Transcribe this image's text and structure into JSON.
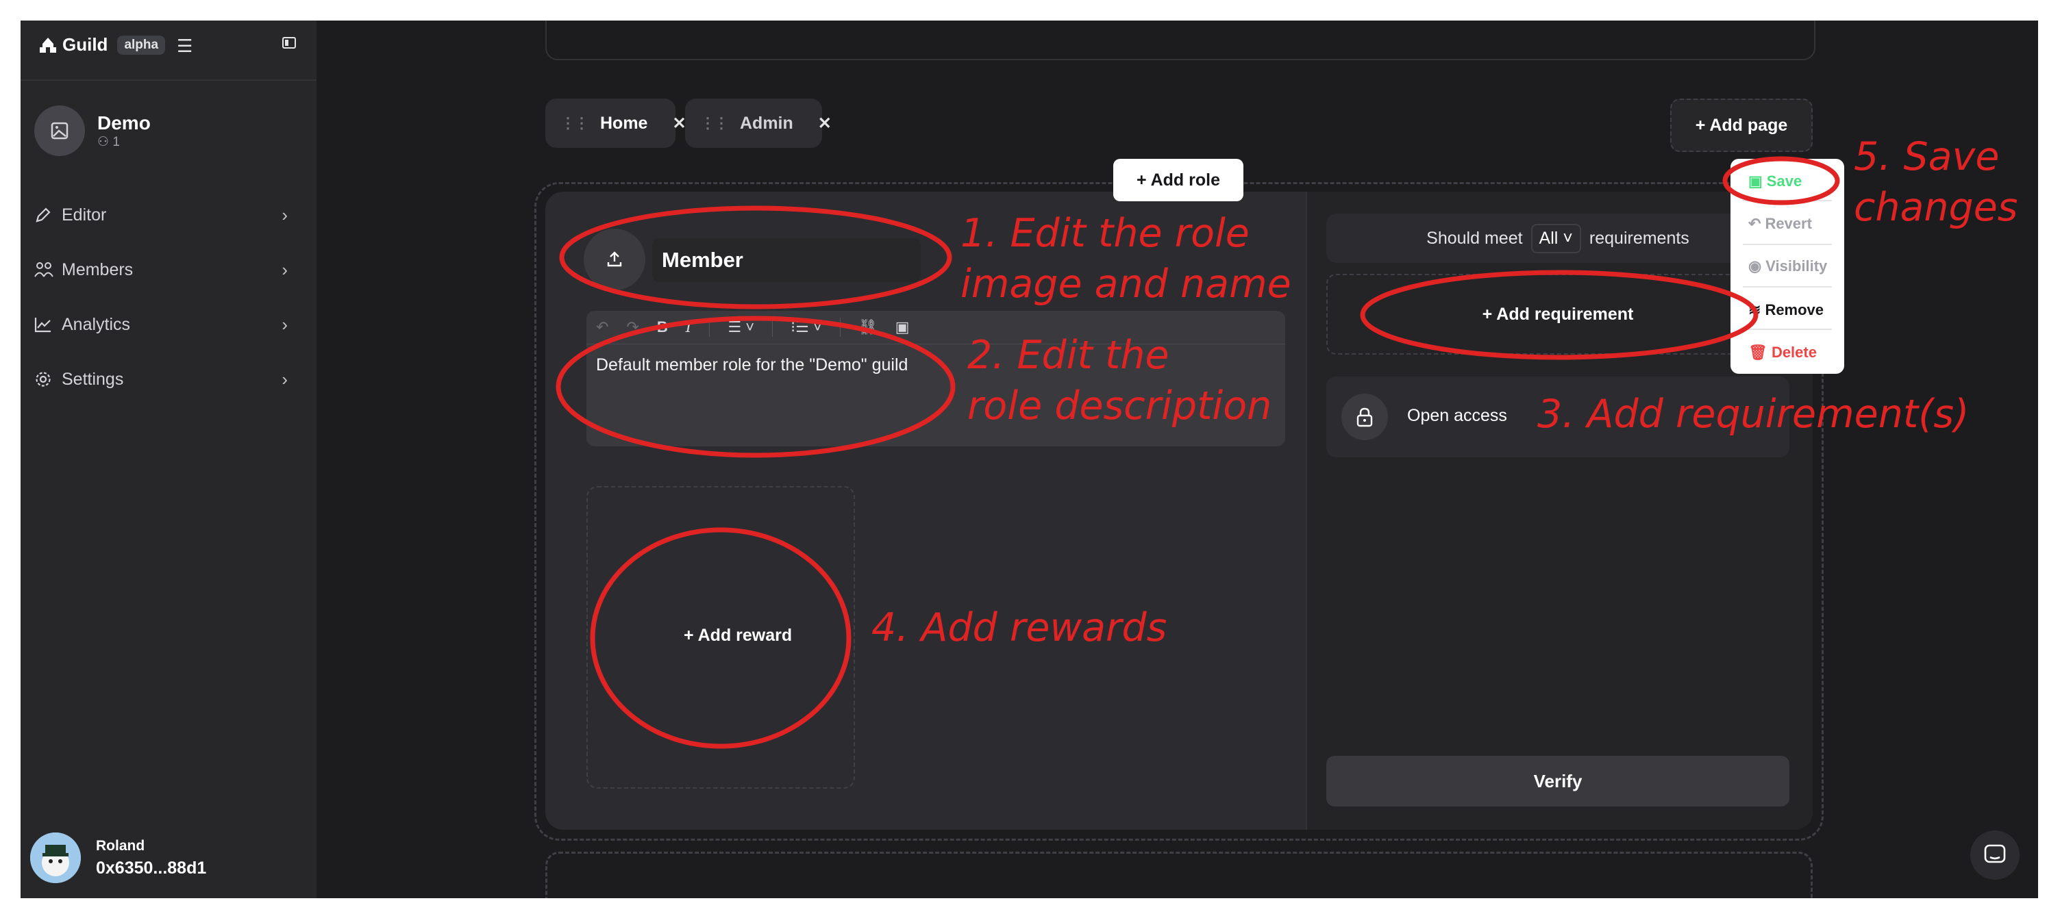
{
  "sidebar": {
    "logo_text": "Guild",
    "badge": "alpha",
    "guild": {
      "name": "Demo",
      "member_count": "1"
    },
    "nav": [
      {
        "label": "Editor",
        "icon": "pen-icon"
      },
      {
        "label": "Members",
        "icon": "users-icon"
      },
      {
        "label": "Analytics",
        "icon": "chart-icon"
      },
      {
        "label": "Settings",
        "icon": "gear-icon"
      }
    ],
    "user": {
      "name": "Roland",
      "address": "0x6350...88d1"
    }
  },
  "tabs": [
    {
      "label": "Home"
    },
    {
      "label": "Admin"
    }
  ],
  "add_page_label": "+ Add page",
  "add_role_label": "+ Add role",
  "role": {
    "name": "Member",
    "description": "Default member role for the \"Demo\" guild",
    "add_reward_label": "+ Add reward"
  },
  "requirements": {
    "prefix": "Should meet",
    "logic": "All",
    "suffix": "requirements",
    "add_label": "+ Add requirement",
    "items": [
      {
        "label": "Open access"
      }
    ],
    "verify_label": "Verify"
  },
  "menu": {
    "save": "Save",
    "revert": "Revert",
    "visibility": "Visibility",
    "remove": "Remove",
    "delete": "Delete"
  },
  "annotations": {
    "step1": "1. Edit the role\nimage and name",
    "step2": "2. Edit the\nrole description",
    "step3": "3. Add requirement(s)",
    "step4": "4. Add rewards",
    "step5": "5. Save\nchanges"
  },
  "colors": {
    "annotation": "#e02424",
    "save_green": "#4ade80",
    "delete_red": "#ef4444"
  }
}
